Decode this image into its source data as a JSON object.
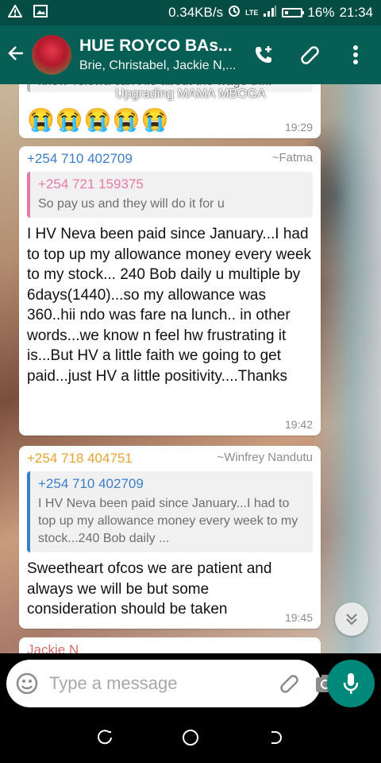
{
  "status_bar": {
    "left_icons": [
      "warning-icon",
      "image-icon"
    ],
    "speed": "0.34KB/s",
    "network": "LTE",
    "battery": "16%",
    "time": "21:34"
  },
  "header": {
    "title": "HUE ROYCO BAs...",
    "subtitle": "Brie, Christabel, Jackie N,...",
    "icons": [
      "back-arrow-icon",
      "add-call-icon",
      "attachment-icon",
      "more-vert-icon"
    ]
  },
  "banner": {
    "text": "Upgrading MAMA MBOGA"
  },
  "messages": [
    {
      "partial_text": "know Telewa can't lie about the wage th...",
      "emoji": "😭😭😭😭😭",
      "time": "19:29"
    },
    {
      "sender": "+254 710 402709",
      "alias": "~Fatma",
      "quote_author": "+254 721 159375",
      "quote_text": "So pay us and they will do it for u",
      "text": "I HV Neva been paid since January...I had to top up my allowance money every week to my stock... 240 Bob daily u multiple by 6days(1440)...so my allowance was 360..hii ndo was fare na lunch.. in other words...we know n feel hw frustrating it is...But HV a little faith we going to get paid...just HV a little positivity....Thanks",
      "time": "19:42"
    },
    {
      "sender": "+254 718 404751",
      "alias": "~Winfrey Nandutu",
      "quote_author": "+254 710 402709",
      "quote_text": "I HV Neva been paid since January...I had to top up my allowance money every week to my stock...240 Bob daily ...",
      "text": "Sweetheart ofcos we are patient and always we will be but some consideration should be taken",
      "time": "19:45"
    },
    {
      "sender": "Jackie N"
    }
  ],
  "input": {
    "placeholder": "Type a message",
    "value": ""
  },
  "colors": {
    "status_bar": "#054d44",
    "app_bar": "#075e54",
    "accent": "#00897b",
    "sender_blue": "#3b7ec8",
    "sender_orange": "#e6a532",
    "quote_pink": "#e879a7"
  }
}
